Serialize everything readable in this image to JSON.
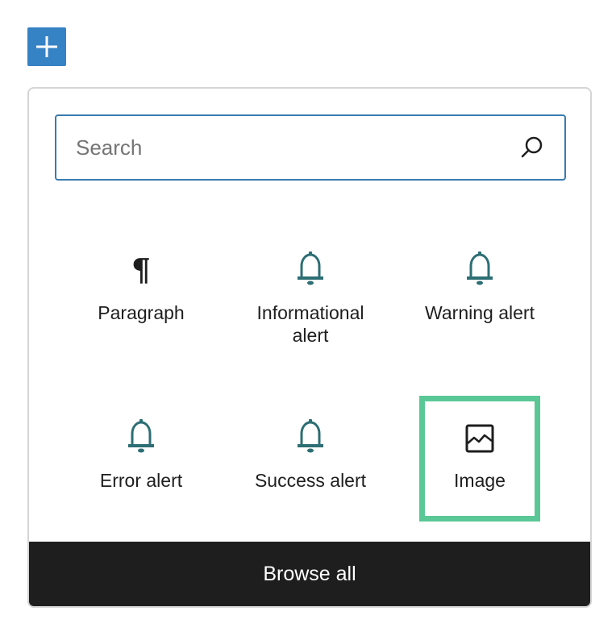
{
  "add_button": {
    "icon": "plus-icon",
    "color": "#3582c4"
  },
  "search": {
    "placeholder": "Search",
    "value": "",
    "icon": "search-icon"
  },
  "blocks": [
    {
      "label": "Paragraph",
      "icon": "pilcrow-icon"
    },
    {
      "label": "Informational alert",
      "icon": "bell-icon"
    },
    {
      "label": "Warning alert",
      "icon": "bell-icon"
    },
    {
      "label": "Error alert",
      "icon": "bell-icon"
    },
    {
      "label": "Success alert",
      "icon": "bell-icon"
    },
    {
      "label": "Image",
      "icon": "image-icon",
      "highlighted": true
    }
  ],
  "browse_all": {
    "label": "Browse all"
  },
  "colors": {
    "accent": "#3582c4",
    "icon_teal": "#2c6e74",
    "highlight": "#5ac896",
    "footer_bg": "#1e1e1e"
  }
}
